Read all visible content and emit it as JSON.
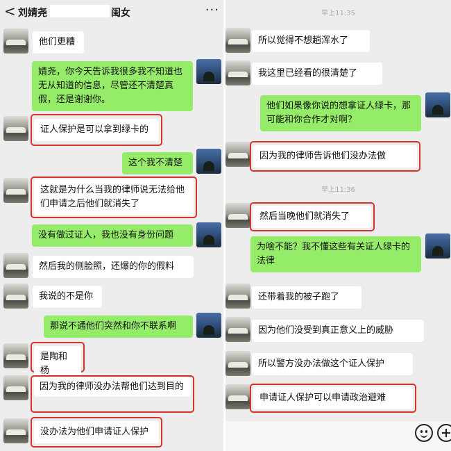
{
  "header": {
    "back_icon": "back-arrow-icon",
    "title_name": "刘婧尧",
    "title_suffix": "闺女",
    "more_icon": "more-dots-icon",
    "more_glyph": "···",
    "back_glyph": "<"
  },
  "left": {
    "messages": [
      {
        "side": "in",
        "text": "他们更糟",
        "highlight": false
      },
      {
        "side": "out",
        "text": "婧尧，你今天告诉我很多我不知道也无从知道的信息，尽管还不清楚真假，还是谢谢你。",
        "highlight": false
      },
      {
        "side": "in",
        "text": "证人保护是可以拿到绿卡的",
        "highlight": true
      },
      {
        "side": "out",
        "text": "这个我不清楚",
        "highlight": false
      },
      {
        "side": "in",
        "text": "这就是为什么当我的律师说无法给他们申请之后他们就消失了",
        "highlight": true
      },
      {
        "side": "out",
        "text": "没有做过证人，我也没有身份问题",
        "highlight": false
      },
      {
        "side": "in",
        "text": "然后我的侧脸照，还爆的你的假料",
        "highlight": false
      },
      {
        "side": "in",
        "text": "我说的不是你",
        "highlight": false
      },
      {
        "side": "out",
        "text": "那说不通他们突然和你不联系啊",
        "highlight": false
      },
      {
        "side": "in",
        "text": "是陶和杨",
        "highlight": true
      },
      {
        "side": "in",
        "text": "因为我的律师没办法帮他们达到目的",
        "highlight": true
      },
      {
        "side": "in",
        "text": "没办法为他们申请证人保护",
        "highlight": true
      }
    ]
  },
  "right": {
    "time_1": "早上11:35",
    "time_2": "早上11:36",
    "messages": [
      {
        "side": "in",
        "text": "所以觉得不想趟浑水了",
        "highlight": false
      },
      {
        "side": "in",
        "text": "我这里已经看的很清楚了",
        "highlight": false
      },
      {
        "side": "out",
        "text": "他们如果像你说的想拿证人绿卡，那可能和你合作才对啊？",
        "highlight": false
      },
      {
        "side": "in",
        "text": "因为我的律师告诉他们没办法做",
        "highlight": true
      },
      {
        "side": "in",
        "text": "然后当晚他们就消失了",
        "highlight": true
      },
      {
        "side": "out",
        "text": "为啥不能？我不懂这些有关证人绿卡的法律",
        "highlight": false
      },
      {
        "side": "in",
        "text": "还带着我的被子跑了",
        "highlight": false
      },
      {
        "side": "in",
        "text": "因为他们没受到真正意义上的威胁",
        "highlight": false
      },
      {
        "side": "in",
        "text": "所以警方没办法做这个证人保护",
        "highlight": false
      },
      {
        "side": "in",
        "text": "申请证人保护可以申请政治避难",
        "highlight": true
      }
    ]
  },
  "input_bar": {
    "emoji_icon": "emoji-face-icon",
    "plus_icon": "plus-circle-icon"
  },
  "colors": {
    "background": "#ededed",
    "incoming_bubble": "#ffffff",
    "outgoing_bubble": "#95ec69",
    "highlight_border": "#d9302c"
  }
}
